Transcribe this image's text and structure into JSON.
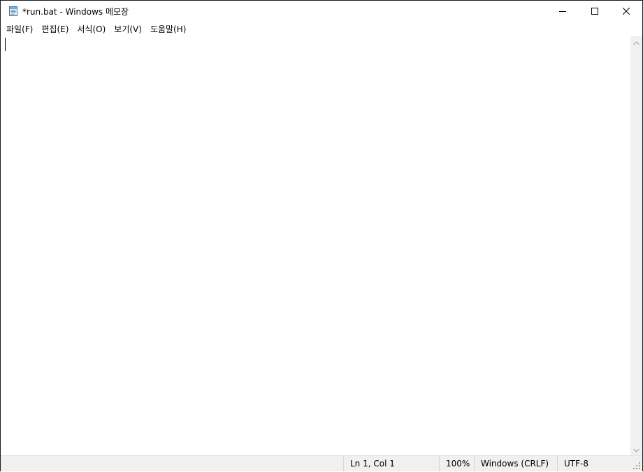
{
  "window": {
    "title": "*run.bat - Windows 메모장",
    "app_icon": "notepad-icon"
  },
  "controls": {
    "minimize_icon": "minimize-icon",
    "maximize_icon": "maximize-icon",
    "close_icon": "close-icon"
  },
  "menu": {
    "items": [
      {
        "label": "파일(F)"
      },
      {
        "label": "편집(E)"
      },
      {
        "label": "서식(O)"
      },
      {
        "label": "보기(V)"
      },
      {
        "label": "도움말(H)"
      }
    ]
  },
  "editor": {
    "content": ""
  },
  "statusbar": {
    "position": "Ln 1, Col 1",
    "zoom": "100%",
    "line_ending": "Windows (CRLF)",
    "encoding": "UTF-8"
  },
  "colors": {
    "window_border": "#1b1b1b",
    "statusbar_bg": "#f0f0f0",
    "scrollbar_bg": "#f0f0f0"
  }
}
